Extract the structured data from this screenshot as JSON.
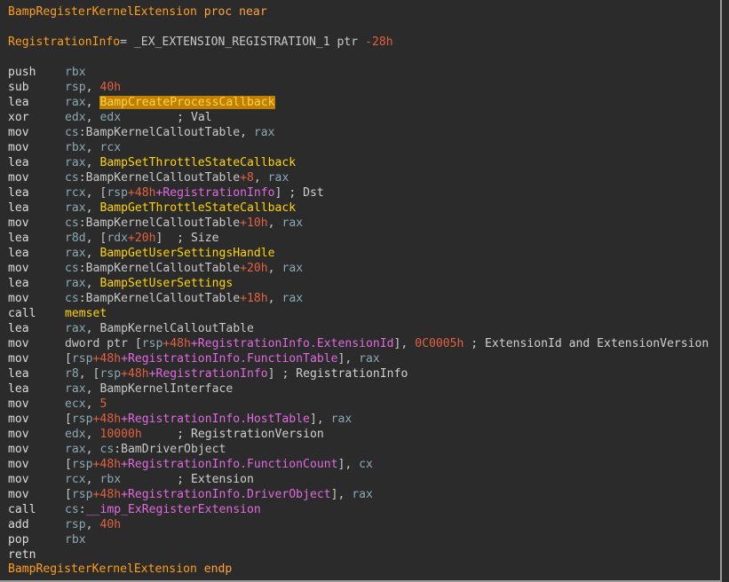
{
  "header": {
    "proc_name": "BampRegisterKernelExtension",
    "proc_kw": "proc near",
    "var_name": "RegistrationInfo",
    "var_eq": "=",
    "var_type": "_EX_EXTENSION_REGISTRATION_1 ptr",
    "var_off": "-28h"
  },
  "footer": {
    "proc_name": "BampRegisterKernelExtension",
    "endp_kw": "endp"
  },
  "lines": [
    {
      "m": "push",
      "t": [
        [
          "reg",
          "rbx"
        ]
      ]
    },
    {
      "m": "sub",
      "t": [
        [
          "reg",
          "rsp"
        ],
        [
          "plain",
          ", "
        ],
        [
          "num",
          "40h"
        ]
      ]
    },
    {
      "m": "lea",
      "t": [
        [
          "reg",
          "rax"
        ],
        [
          "plain",
          ", "
        ],
        [
          "fnhl",
          "BampCreateProcessCallback"
        ]
      ]
    },
    {
      "m": "xor",
      "t": [
        [
          "reg",
          "edx"
        ],
        [
          "plain",
          ", "
        ],
        [
          "reg",
          "edx"
        ],
        [
          "plain",
          "        "
        ],
        [
          "cmt",
          "; Val"
        ]
      ]
    },
    {
      "m": "mov",
      "t": [
        [
          "reg",
          "cs"
        ],
        [
          "plain",
          ":"
        ],
        [
          "glob",
          "BampKernelCalloutTable"
        ],
        [
          "plain",
          ", "
        ],
        [
          "reg",
          "rax"
        ]
      ]
    },
    {
      "m": "mov",
      "t": [
        [
          "reg",
          "rbx"
        ],
        [
          "plain",
          ", "
        ],
        [
          "reg",
          "rcx"
        ]
      ]
    },
    {
      "m": "lea",
      "t": [
        [
          "reg",
          "rax"
        ],
        [
          "plain",
          ", "
        ],
        [
          "fn",
          "BampSetThrottleStateCallback"
        ]
      ]
    },
    {
      "m": "mov",
      "t": [
        [
          "reg",
          "cs"
        ],
        [
          "plain",
          ":"
        ],
        [
          "glob",
          "BampKernelCalloutTable"
        ],
        [
          "num",
          "+8"
        ],
        [
          "plain",
          ", "
        ],
        [
          "reg",
          "rax"
        ]
      ]
    },
    {
      "m": "lea",
      "t": [
        [
          "reg",
          "rcx"
        ],
        [
          "plain",
          ", ["
        ],
        [
          "reg",
          "rsp"
        ],
        [
          "num",
          "+48h"
        ],
        [
          "fld",
          "+RegistrationInfo"
        ],
        [
          "plain",
          "] "
        ],
        [
          "cmt",
          "; Dst"
        ]
      ]
    },
    {
      "m": "lea",
      "t": [
        [
          "reg",
          "rax"
        ],
        [
          "plain",
          ", "
        ],
        [
          "fn",
          "BampGetThrottleStateCallback"
        ]
      ]
    },
    {
      "m": "mov",
      "t": [
        [
          "reg",
          "cs"
        ],
        [
          "plain",
          ":"
        ],
        [
          "glob",
          "BampKernelCalloutTable"
        ],
        [
          "num",
          "+10h"
        ],
        [
          "plain",
          ", "
        ],
        [
          "reg",
          "rax"
        ]
      ]
    },
    {
      "m": "lea",
      "t": [
        [
          "reg",
          "r8d"
        ],
        [
          "plain",
          ", ["
        ],
        [
          "reg",
          "rdx"
        ],
        [
          "num",
          "+20h"
        ],
        [
          "plain",
          "]  "
        ],
        [
          "cmt",
          "; Size"
        ]
      ]
    },
    {
      "m": "lea",
      "t": [
        [
          "reg",
          "rax"
        ],
        [
          "plain",
          ", "
        ],
        [
          "fn",
          "BampGetUserSettingsHandle"
        ]
      ]
    },
    {
      "m": "mov",
      "t": [
        [
          "reg",
          "cs"
        ],
        [
          "plain",
          ":"
        ],
        [
          "glob",
          "BampKernelCalloutTable"
        ],
        [
          "num",
          "+20h"
        ],
        [
          "plain",
          ", "
        ],
        [
          "reg",
          "rax"
        ]
      ]
    },
    {
      "m": "lea",
      "t": [
        [
          "reg",
          "rax"
        ],
        [
          "plain",
          ", "
        ],
        [
          "fn",
          "BampSetUserSettings"
        ]
      ]
    },
    {
      "m": "mov",
      "t": [
        [
          "reg",
          "cs"
        ],
        [
          "plain",
          ":"
        ],
        [
          "glob",
          "BampKernelCalloutTable"
        ],
        [
          "num",
          "+18h"
        ],
        [
          "plain",
          ", "
        ],
        [
          "reg",
          "rax"
        ]
      ]
    },
    {
      "m": "call",
      "t": [
        [
          "fn",
          "memset"
        ]
      ]
    },
    {
      "m": "lea",
      "t": [
        [
          "reg",
          "rax"
        ],
        [
          "plain",
          ", "
        ],
        [
          "glob",
          "BampKernelCalloutTable"
        ]
      ]
    },
    {
      "m": "mov",
      "t": [
        [
          "plain",
          "dword ptr ["
        ],
        [
          "reg",
          "rsp"
        ],
        [
          "num",
          "+48h"
        ],
        [
          "fld",
          "+RegistrationInfo.ExtensionId"
        ],
        [
          "plain",
          "], "
        ],
        [
          "num",
          "0C0005h"
        ],
        [
          "plain",
          " "
        ],
        [
          "cmt",
          "; ExtensionId and ExtensionVersion"
        ]
      ]
    },
    {
      "m": "mov",
      "t": [
        [
          "plain",
          "["
        ],
        [
          "reg",
          "rsp"
        ],
        [
          "num",
          "+48h"
        ],
        [
          "fld",
          "+RegistrationInfo.FunctionTable"
        ],
        [
          "plain",
          "], "
        ],
        [
          "reg",
          "rax"
        ]
      ]
    },
    {
      "m": "lea",
      "t": [
        [
          "reg",
          "r8"
        ],
        [
          "plain",
          ", ["
        ],
        [
          "reg",
          "rsp"
        ],
        [
          "num",
          "+48h"
        ],
        [
          "fld",
          "+RegistrationInfo"
        ],
        [
          "plain",
          "] "
        ],
        [
          "cmt",
          "; RegistrationInfo"
        ]
      ]
    },
    {
      "m": "lea",
      "t": [
        [
          "reg",
          "rax"
        ],
        [
          "plain",
          ", "
        ],
        [
          "glob",
          "BampKernelInterface"
        ]
      ]
    },
    {
      "m": "mov",
      "t": [
        [
          "reg",
          "ecx"
        ],
        [
          "plain",
          ", "
        ],
        [
          "num",
          "5"
        ]
      ]
    },
    {
      "m": "mov",
      "t": [
        [
          "plain",
          "["
        ],
        [
          "reg",
          "rsp"
        ],
        [
          "num",
          "+48h"
        ],
        [
          "fld",
          "+RegistrationInfo.HostTable"
        ],
        [
          "plain",
          "], "
        ],
        [
          "reg",
          "rax"
        ]
      ]
    },
    {
      "m": "mov",
      "t": [
        [
          "reg",
          "edx"
        ],
        [
          "plain",
          ", "
        ],
        [
          "num",
          "10000h"
        ],
        [
          "plain",
          "     "
        ],
        [
          "cmt",
          "; RegistrationVersion"
        ]
      ]
    },
    {
      "m": "mov",
      "t": [
        [
          "reg",
          "rax"
        ],
        [
          "plain",
          ", "
        ],
        [
          "reg",
          "cs"
        ],
        [
          "plain",
          ":"
        ],
        [
          "glob",
          "BamDriverObject"
        ]
      ]
    },
    {
      "m": "mov",
      "t": [
        [
          "plain",
          "["
        ],
        [
          "reg",
          "rsp"
        ],
        [
          "num",
          "+48h"
        ],
        [
          "fld",
          "+RegistrationInfo.FunctionCount"
        ],
        [
          "plain",
          "], "
        ],
        [
          "reg",
          "cx"
        ]
      ]
    },
    {
      "m": "mov",
      "t": [
        [
          "reg",
          "rcx"
        ],
        [
          "plain",
          ", "
        ],
        [
          "reg",
          "rbx"
        ],
        [
          "plain",
          "        "
        ],
        [
          "cmt",
          "; Extension"
        ]
      ]
    },
    {
      "m": "mov",
      "t": [
        [
          "plain",
          "["
        ],
        [
          "reg",
          "rsp"
        ],
        [
          "num",
          "+48h"
        ],
        [
          "fld",
          "+RegistrationInfo.DriverObject"
        ],
        [
          "plain",
          "], "
        ],
        [
          "reg",
          "rax"
        ]
      ]
    },
    {
      "m": "call",
      "t": [
        [
          "reg",
          "cs"
        ],
        [
          "plain",
          ":"
        ],
        [
          "pnk",
          "__imp_ExRegisterExtension"
        ]
      ]
    },
    {
      "m": "add",
      "t": [
        [
          "reg",
          "rsp"
        ],
        [
          "plain",
          ", "
        ],
        [
          "num",
          "40h"
        ]
      ]
    },
    {
      "m": "pop",
      "t": [
        [
          "reg",
          "rbx"
        ]
      ]
    },
    {
      "m": "retn",
      "t": []
    }
  ]
}
